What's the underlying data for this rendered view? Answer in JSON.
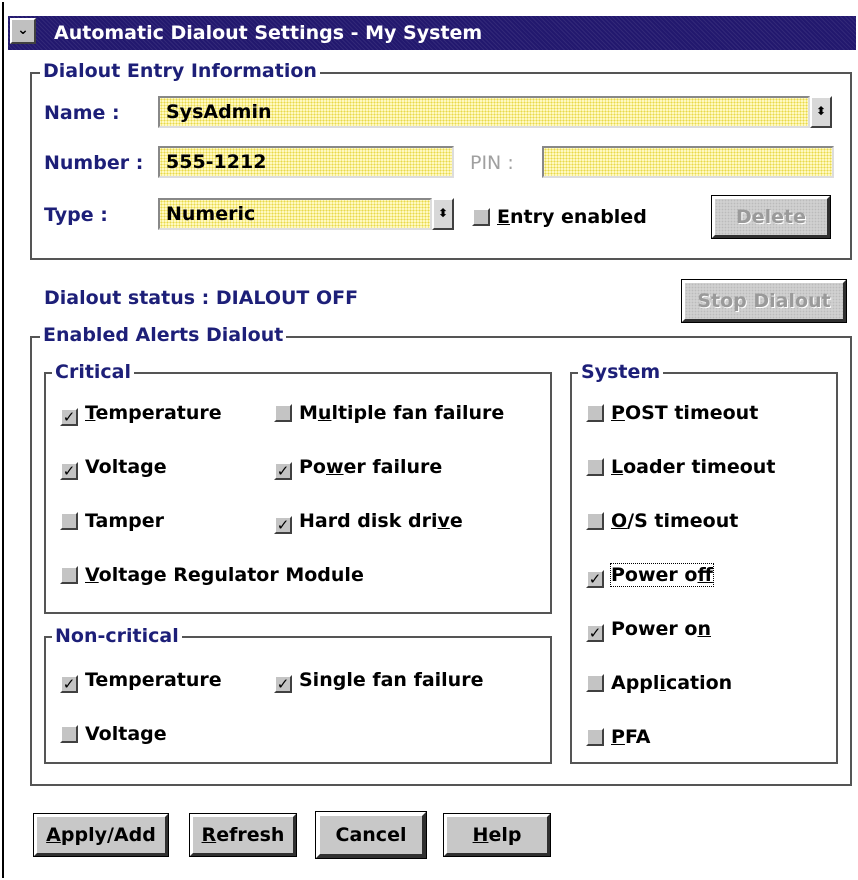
{
  "window": {
    "title": "Automatic Dialout Settings - My System",
    "system_menu_glyph": "⌄"
  },
  "entry": {
    "legend": "Dialout Entry Information",
    "name_label": "Name :",
    "name_value": "SysAdmin",
    "number_label": "Number :",
    "number_value": "555-1212",
    "pin_label": "PIN :",
    "pin_value": "",
    "type_label": "Type :",
    "type_value": "Numeric",
    "entry_enabled_label": "Entry enabled",
    "entry_enabled_checked": false,
    "delete_label": "Delete"
  },
  "status": {
    "text": "Dialout status : DIALOUT OFF",
    "stop_label": "Stop Dialout"
  },
  "alerts": {
    "legend": "Enabled Alerts Dialout",
    "critical": {
      "legend": "Critical",
      "items": [
        {
          "label": "Temperature",
          "checked": true
        },
        {
          "label": "Multiple fan failure",
          "checked": false
        },
        {
          "label": "Voltage",
          "checked": true
        },
        {
          "label": "Power failure",
          "checked": true
        },
        {
          "label": "Tamper",
          "checked": false
        },
        {
          "label": "Hard disk drive",
          "checked": true
        },
        {
          "label": "Voltage Regulator Module",
          "checked": false
        }
      ]
    },
    "noncritical": {
      "legend": "Non-critical",
      "items": [
        {
          "label": "Temperature",
          "checked": true
        },
        {
          "label": "Single fan failure",
          "checked": true
        },
        {
          "label": "Voltage",
          "checked": false
        }
      ]
    },
    "system": {
      "legend": "System",
      "items": [
        {
          "label": "POST timeout",
          "checked": false
        },
        {
          "label": "Loader timeout",
          "checked": false
        },
        {
          "label": "O/S timeout",
          "checked": false
        },
        {
          "label": "Power off",
          "checked": true
        },
        {
          "label": "Power on",
          "checked": true
        },
        {
          "label": "Application",
          "checked": false
        },
        {
          "label": "PFA",
          "checked": false
        }
      ]
    }
  },
  "buttons": {
    "apply": "Apply/Add",
    "refresh": "Refresh",
    "cancel": "Cancel",
    "help": "Help"
  },
  "colors": {
    "titlebar": "#22186e",
    "label_text": "#1d1f78",
    "field_bg": "#fff9c0"
  },
  "icons": {
    "check": "✓",
    "dropdown": "⬍"
  }
}
